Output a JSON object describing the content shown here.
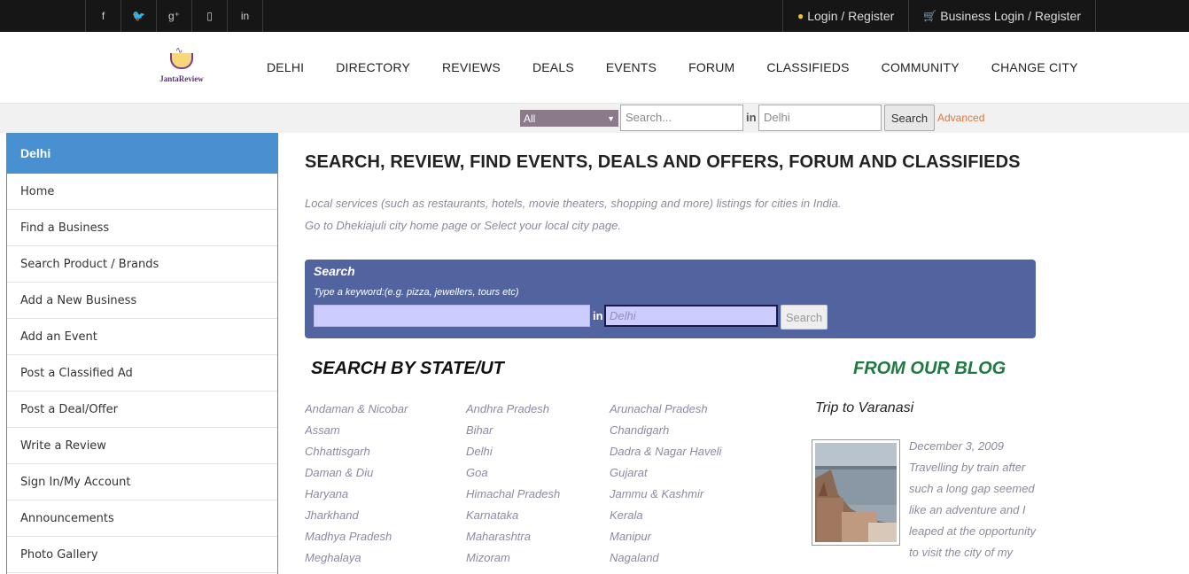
{
  "topbar": {
    "social": [
      {
        "icon": "facebook-icon",
        "glyph": "f"
      },
      {
        "icon": "twitter-icon",
        "glyph": "🐦"
      },
      {
        "icon": "google-plus-icon",
        "glyph": "g⁺"
      },
      {
        "icon": "phone-icon",
        "glyph": "▯"
      },
      {
        "icon": "linkedin-icon",
        "glyph": "in"
      }
    ],
    "login": "Login / Register",
    "business_login": "Business Login / Register"
  },
  "header": {
    "logo_text": "JantaReview",
    "nav": [
      "DELHI",
      "DIRECTORY",
      "REVIEWS",
      "DEALS",
      "EVENTS",
      "FORUM",
      "CLASSIFIEDS",
      "COMMUNITY",
      "CHANGE CITY"
    ]
  },
  "search_strip": {
    "category": "All",
    "search_placeholder": "Search...",
    "in_label": "in",
    "city_value": "Delhi",
    "button": "Search",
    "advanced": "Advanced"
  },
  "sidebar": {
    "heading": "Delhi",
    "items": [
      "Home",
      "Find a Business",
      "Search Product / Brands",
      "Add a New Business",
      "Add an Event",
      "Post a Classified Ad",
      "Post a Deal/Offer",
      "Write a Review",
      "Sign In/My Account",
      "Announcements",
      "Photo Gallery"
    ]
  },
  "main": {
    "title": "SEARCH, REVIEW, FIND EVENTS, DEALS AND OFFERS, FORUM AND CLASSIFIEDS",
    "intro_line1": "Local services (such as restaurants, hotels, movie theaters, shopping and more) listings for cities in India.",
    "intro_line2": "Go to Dhekiajuli city home page or Select your local city page."
  },
  "search_box": {
    "title": "Search",
    "hint": "Type a keyword:(e.g. pizza, jewellers, tours etc)",
    "in_label": "in",
    "city_placeholder": "Delhi",
    "button": "Search"
  },
  "states": {
    "heading": "SEARCH BY STATE/UT",
    "col1": [
      "Andaman & Nicobar",
      "Assam",
      "Chhattisgarh",
      "Daman & Diu",
      "Haryana",
      "Jharkhand",
      "Madhya Pradesh",
      "Meghalaya"
    ],
    "col2": [
      "Andhra Pradesh",
      "Bihar",
      "Delhi",
      "Goa",
      "Himachal Pradesh",
      "Karnataka",
      "Maharashtra",
      "Mizoram"
    ],
    "col3": [
      "Arunachal Pradesh",
      "Chandigarh",
      "Dadra & Nagar Haveli",
      "Gujarat",
      "Jammu & Kashmir",
      "Kerala",
      "Manipur",
      "Nagaland"
    ]
  },
  "blog": {
    "heading": "FROM OUR BLOG",
    "post_title": "Trip to Varanasi",
    "date": "December 3, 2009",
    "excerpt": "Travelling by train after such a long gap seemed like an adventure and I leaped at the opportunity to visit the city of my"
  }
}
